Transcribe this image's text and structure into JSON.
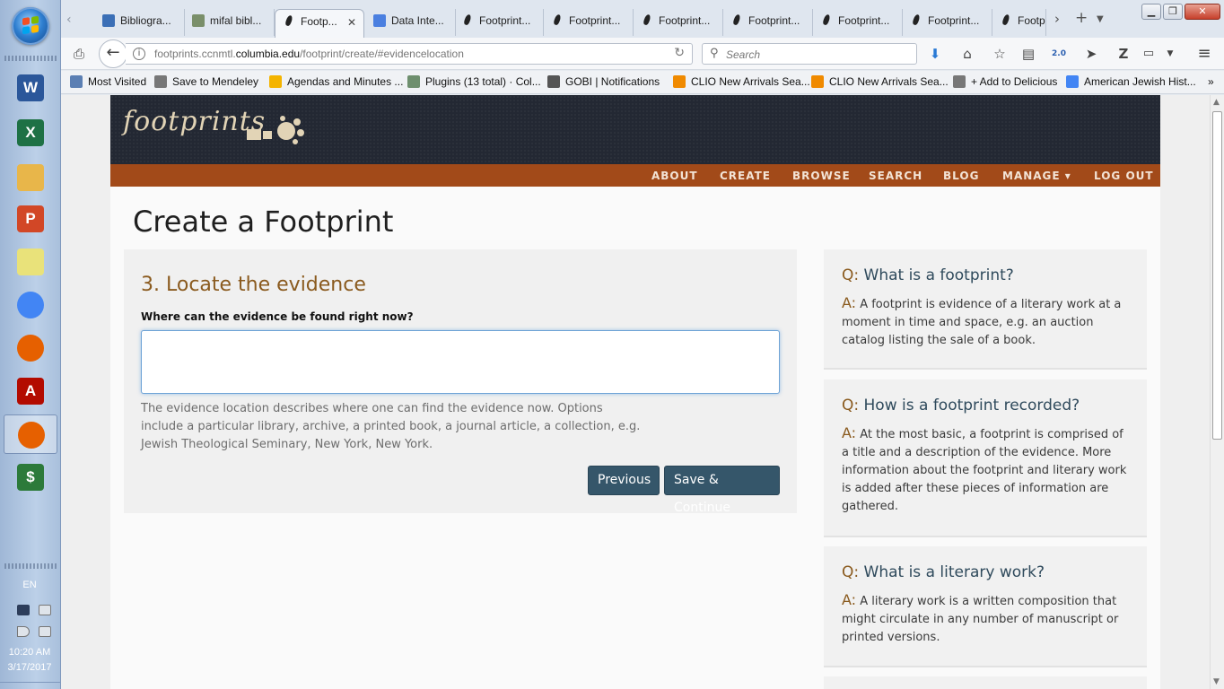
{
  "taskbar": {
    "apps": [
      {
        "name": "word-taskbar-icon",
        "letter": "W",
        "color": "#2b579a"
      },
      {
        "name": "excel-taskbar-icon",
        "letter": "X",
        "color": "#1e7145"
      },
      {
        "name": "file-explorer-taskbar-icon",
        "letter": "",
        "color": "#e8b64a"
      },
      {
        "name": "powerpoint-taskbar-icon",
        "letter": "P",
        "color": "#d24726"
      },
      {
        "name": "sticky-notes-taskbar-icon",
        "letter": "",
        "color": "#e9e27a"
      },
      {
        "name": "chrome-taskbar-icon",
        "letter": "",
        "color": "#4285f4"
      },
      {
        "name": "firefox-taskbar-icon",
        "letter": "",
        "color": "#e66000"
      },
      {
        "name": "acrobat-taskbar-icon",
        "letter": "A",
        "color": "#b30b00"
      },
      {
        "name": "firefox-active-taskbar-icon",
        "letter": "",
        "color": "#e66000"
      },
      {
        "name": "money-app-taskbar-icon",
        "letter": "$",
        "color": "#2c7a3a"
      }
    ],
    "language": "EN",
    "time": "10:20 AM",
    "date": "3/17/2017"
  },
  "tabs": [
    {
      "label": "Bibliogra...",
      "fav": "book"
    },
    {
      "label": "mifal bibl...",
      "fav": "img"
    },
    {
      "label": "Footp...",
      "fav": "fp",
      "active": true
    },
    {
      "label": "Data Inte...",
      "fav": "doc"
    },
    {
      "label": "Footprint...",
      "fav": "fp"
    },
    {
      "label": "Footprint...",
      "fav": "fp"
    },
    {
      "label": "Footprint...",
      "fav": "fp"
    },
    {
      "label": "Footprint...",
      "fav": "fp"
    },
    {
      "label": "Footprint...",
      "fav": "fp"
    },
    {
      "label": "Footprint...",
      "fav": "fp"
    },
    {
      "label": "Footpr",
      "fav": "fp"
    }
  ],
  "navbar": {
    "url_host": "footprints.ccnmtl.",
    "url_domain": "columbia.edu",
    "url_path": "/footprint/create/#evidencelocation",
    "search_placeholder": "Search"
  },
  "bookmarks": [
    {
      "label": "Most Visited",
      "color": "#5b7fb3"
    },
    {
      "label": "Save to Mendeley",
      "color": "#777777"
    },
    {
      "label": "Agendas and Minutes ...",
      "color": "#f4b400"
    },
    {
      "label": "Plugins (13 total) · Col...",
      "color": "#6e8f6e"
    },
    {
      "label": "GOBI | Notifications",
      "color": "#555555"
    },
    {
      "label": "CLIO New Arrivals Sea...",
      "color": "#f08a00"
    },
    {
      "label": "CLIO New Arrivals Sea...",
      "color": "#f08a00"
    },
    {
      "label": "+ Add to Delicious",
      "color": "#777777"
    },
    {
      "label": "American Jewish Hist...",
      "color": "#4285f4"
    }
  ],
  "site": {
    "logo_text": "footprints",
    "nav": [
      "ABOUT",
      "CREATE",
      "BROWSE",
      "SEARCH",
      "BLOG",
      "MANAGE ▾",
      "LOG OUT"
    ],
    "page_title": "Create a Footprint"
  },
  "form": {
    "step_title": "3. Locate the evidence",
    "field_label": "Where can the evidence be found right now?",
    "field_value": "",
    "help_lines": [
      "The evidence location describes where one can find the evidence now. Options",
      "include a particular library, archive, a printed book, a journal article, a collection, e.g.",
      "Jewish Theological Seminary, New York, New York."
    ],
    "previous_label": "Previous",
    "save_label": "Save & Continue"
  },
  "faq": [
    {
      "q_key": "Q:",
      "question": "What is a footprint?",
      "a_key": "A:",
      "answer": "A footprint is evidence of a literary work at a moment in time and space, e.g. an auction catalog listing the sale of a book."
    },
    {
      "q_key": "Q:",
      "question": "How is a footprint recorded?",
      "a_key": "A:",
      "answer": "At the most basic, a footprint is comprised of a title and a description of the evidence. More information about the footprint and literary work is added after these pieces of information are gathered."
    },
    {
      "q_key": "Q:",
      "question": "What is a literary work?",
      "a_key": "A:",
      "answer": "A literary work is a written composition that might circulate in any number of manuscript or printed versions."
    }
  ]
}
